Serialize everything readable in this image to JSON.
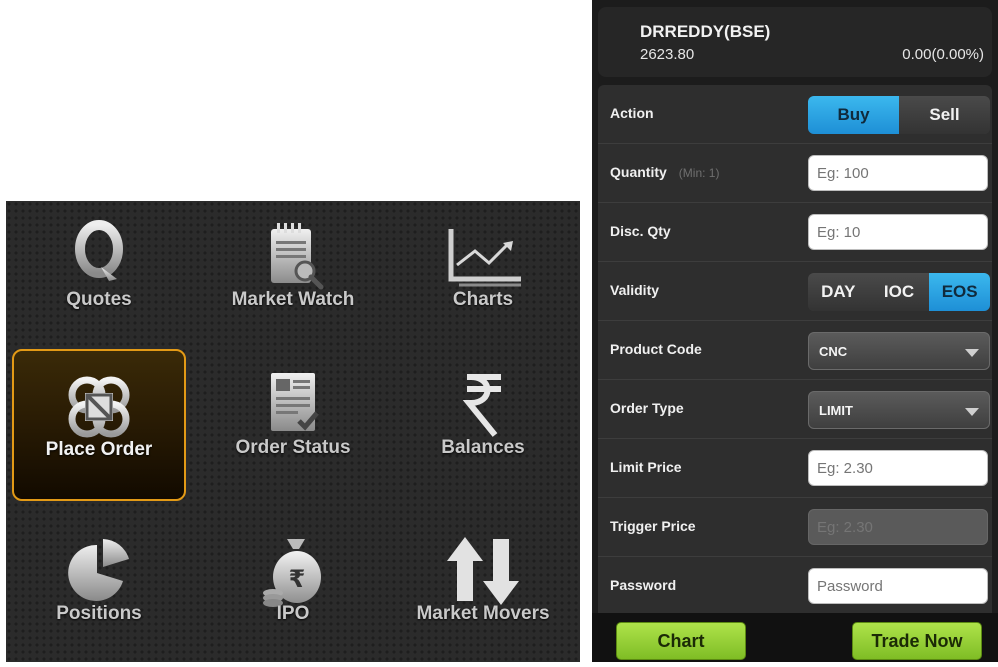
{
  "menu": {
    "items": [
      {
        "label": "Quotes",
        "icon": "quotes-q-icon"
      },
      {
        "label": "Market Watch",
        "icon": "market-watch-icon"
      },
      {
        "label": "Charts",
        "icon": "line-chart-icon"
      },
      {
        "label": "Place Order",
        "icon": "place-order-icon",
        "selected": true
      },
      {
        "label": "Order Status",
        "icon": "order-status-icon"
      },
      {
        "label": "Balances",
        "icon": "rupee-icon"
      },
      {
        "label": "Positions",
        "icon": "pie-chart-icon"
      },
      {
        "label": "IPO",
        "icon": "money-bag-icon"
      },
      {
        "label": "Market Movers",
        "icon": "up-down-arrows-icon"
      }
    ]
  },
  "quote": {
    "symbol": "DRREDDY(BSE)",
    "price": "2623.80",
    "change": "0.00(0.00%)"
  },
  "form": {
    "action": {
      "label": "Action",
      "options": [
        "Buy",
        "Sell"
      ],
      "selected": "Buy"
    },
    "quantity": {
      "label": "Quantity",
      "hint": "(Min: 1)",
      "placeholder": "Eg: 100"
    },
    "disc_qty": {
      "label": "Disc. Qty",
      "placeholder": "Eg: 10"
    },
    "validity": {
      "label": "Validity",
      "options": [
        "DAY",
        "IOC",
        "EOS"
      ],
      "selected": "EOS"
    },
    "product_code": {
      "label": "Product Code",
      "value": "CNC"
    },
    "order_type": {
      "label": "Order Type",
      "value": "LIMIT"
    },
    "limit_price": {
      "label": "Limit Price",
      "placeholder": "Eg: 2.30"
    },
    "trigger_price": {
      "label": "Trigger Price",
      "placeholder": "Eg: 2.30"
    },
    "password": {
      "label": "Password",
      "placeholder": "Password"
    }
  },
  "footer": {
    "chart_label": "Chart",
    "trade_label": "Trade Now"
  },
  "colors": {
    "accent_blue": "#2aa7e6",
    "accent_green": "#9bd63c",
    "selected_border": "#e39a16"
  }
}
